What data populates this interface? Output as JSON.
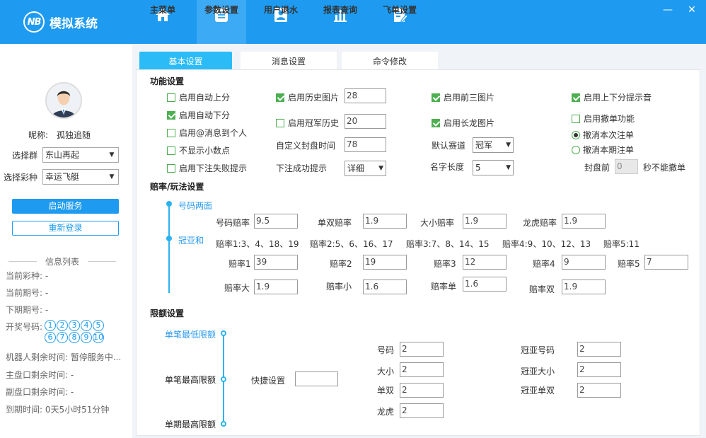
{
  "app": {
    "logo_text": "NB",
    "title": "模拟系统"
  },
  "nav": [
    {
      "label": "主菜单",
      "icon": "home-icon"
    },
    {
      "label": "参数设置",
      "icon": "settings-list-icon"
    },
    {
      "label": "用户退水",
      "icon": "user-card-icon"
    },
    {
      "label": "报表查询",
      "icon": "bar-chart-icon"
    },
    {
      "label": "飞单设置",
      "icon": "edit-document-icon"
    }
  ],
  "window": {
    "minimize": "—",
    "close": "✕"
  },
  "left": {
    "nickname_label": "昵称:",
    "nickname": "孤独追随",
    "group_label": "选择群",
    "group_value": "东山再起",
    "lottery_label": "选择彩种",
    "lottery_value": "幸运飞艇",
    "start_button": "启动服务",
    "relogin_button": "重新登录",
    "info_title": "信息列表",
    "info": {
      "current_lottery": "当前彩种: -",
      "current_period": "当前期号: -",
      "next_period": "下期期号: -",
      "draw_label": "开奖号码:",
      "draw_numbers_row1": [
        "1",
        "2",
        "3",
        "4",
        "5"
      ],
      "draw_numbers_row2": [
        "6",
        "7",
        "8",
        "9",
        "10"
      ],
      "robot_time": "机器人剩余时间:  暂停服务中...",
      "main_time": "主盘口剩余时间:  -",
      "sub_time": "副盘口剩余时间:  -",
      "expire_time": "到期时间:  0天5小时51分钟"
    }
  },
  "tabs": [
    "基本设置",
    "消息设置",
    "命令修改"
  ],
  "func": {
    "title": "功能设置",
    "auto_up": "启用自动上分",
    "auto_down": "启用自动下分",
    "at_msg": "启用@消息到个人",
    "no_decimal": "不显示小数点",
    "bet_fail": "启用下注失败提示",
    "history_img": "启用历史图片",
    "history_img_value": "28",
    "champion_history": "启用冠军历史",
    "champion_history_value": "20",
    "custom_close_label": "自定义封盘时间",
    "custom_close_value": "78",
    "bet_success_label": "下注成功提示",
    "bet_success_value": "详细",
    "top3_img": "启用前三图片",
    "long_dragon_img": "启用长龙图片",
    "default_track_label": "默认赛道",
    "default_track_value": "冠军",
    "name_len_label": "名字长度",
    "name_len_value": "5",
    "updown_sound": "启用上下分提示音",
    "cancel_func": "启用撤单功能",
    "cancel_this": "撤消本次注单",
    "cancel_period": "撤消本期注单",
    "close_before": "封盘前",
    "close_before_value": "0",
    "close_after": "秒不能撤单"
  },
  "odds": {
    "title": "赔率/玩法设置",
    "tree_number": "号码两面",
    "tree_sum": "冠亚和",
    "number_label": "号码赔率",
    "number_value": "9.5",
    "oddeven_label": "单双赔率",
    "oddeven_value": "1.9",
    "bigsmall_label": "大小赔率",
    "bigsmall_value": "1.9",
    "dragon_label": "龙虎赔率",
    "dragon_value": "1.9",
    "desc1": "赔率1:3、4、18、19",
    "desc2": "赔率2:5、6、16、17",
    "desc3": "赔率3:7、8、14、15",
    "desc4": "赔率4:9、10、12、13",
    "desc5": "赔率5:11",
    "r1_label": "赔率1",
    "r1_value": "39",
    "r2_label": "赔率2",
    "r2_value": "19",
    "r3_label": "赔率3",
    "r3_value": "12",
    "r4_label": "赔率4",
    "r4_value": "9",
    "r5_label": "赔率5",
    "r5_value": "7",
    "big_label": "赔率大",
    "big_value": "1.9",
    "small_label": "赔率小",
    "small_value": "1.6",
    "odd_label": "赔率单",
    "odd_value": "1.6",
    "even_label": "赔率双",
    "even_value": "1.9"
  },
  "limits": {
    "title": "限额设置",
    "min_single": "单笔最低限额",
    "max_single": "单笔最高限额",
    "max_period": "单期最高限额",
    "quick_label": "快捷设置",
    "quick_value": "",
    "number_label": "号码",
    "number_value": "2",
    "bigsmall_label": "大小",
    "bigsmall_value": "2",
    "oddeven_label": "单双",
    "oddeven_value": "2",
    "dragon_label": "龙虎",
    "dragon_value": "2",
    "sum_number_label": "冠亚号码",
    "sum_number_value": "2",
    "sum_bigsmall_label": "冠亚大小",
    "sum_bigsmall_value": "2",
    "sum_oddeven_label": "冠亚单双",
    "sum_oddeven_value": "2"
  },
  "colors": {
    "primary": "#1e9bf0",
    "tab_active": "#2bbcf7",
    "checkbox": "#4caf50"
  }
}
